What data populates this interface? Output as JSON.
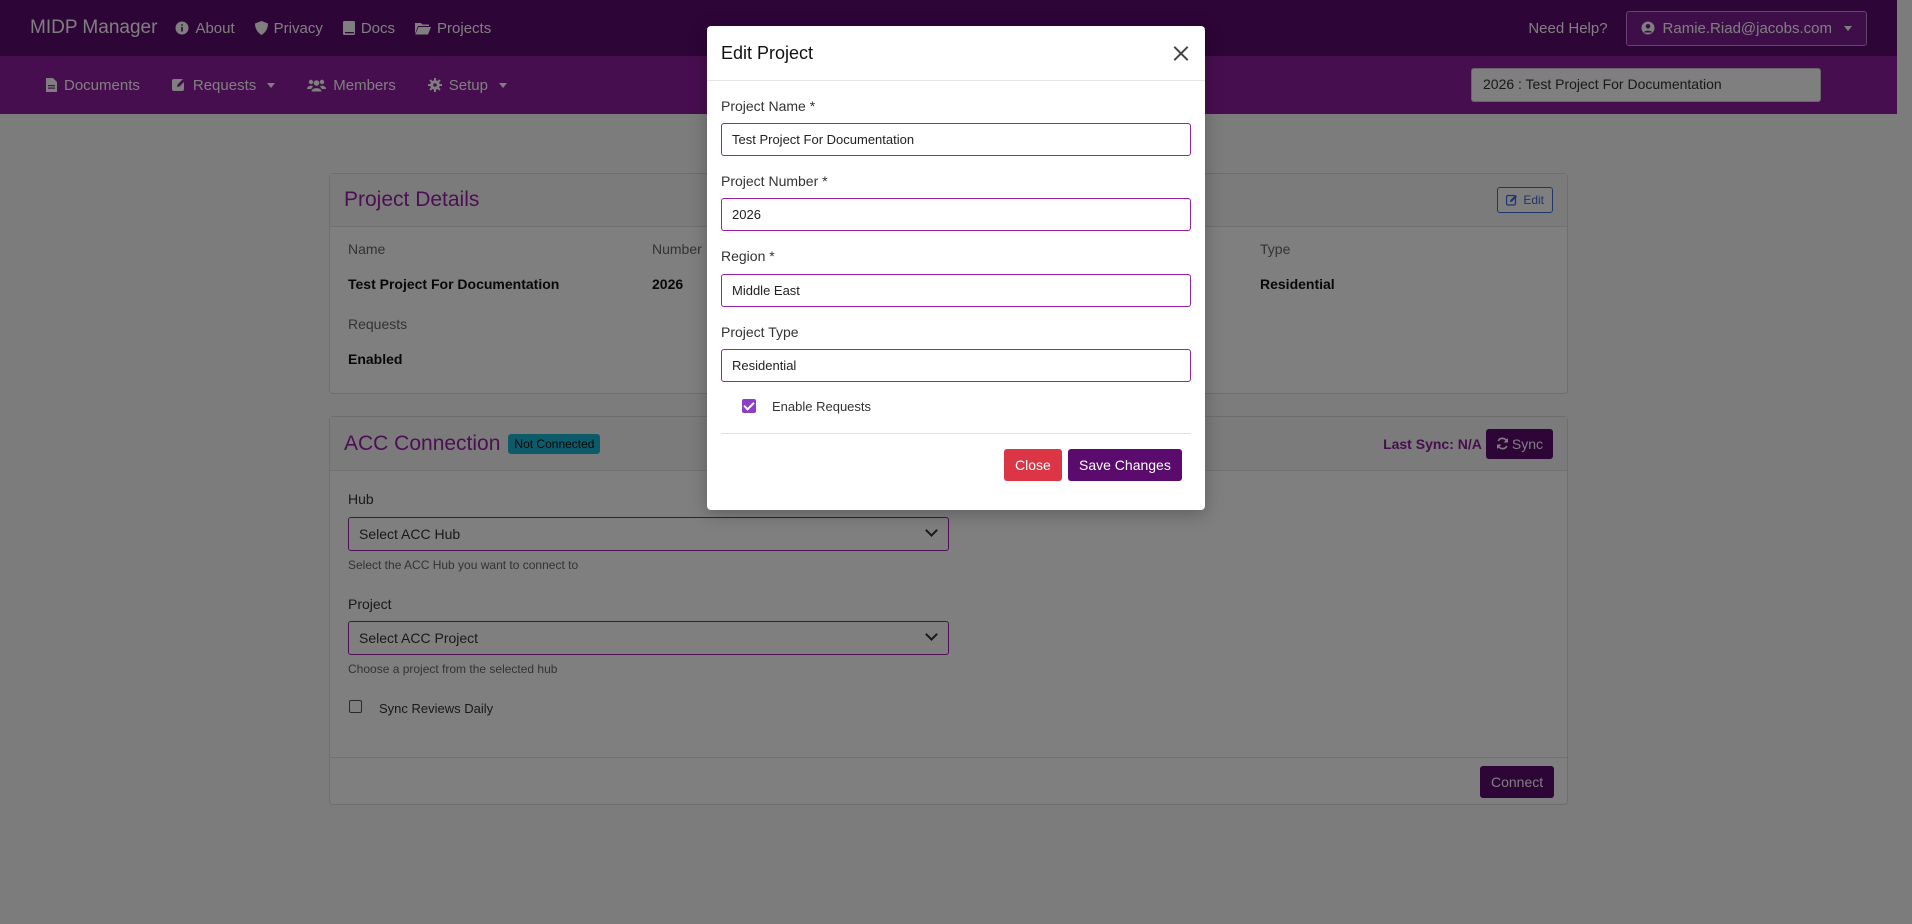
{
  "topbar": {
    "brand": "MIDP Manager",
    "nav": [
      {
        "label": "About",
        "icon": "info-icon"
      },
      {
        "label": "Privacy",
        "icon": "shield-icon"
      },
      {
        "label": "Docs",
        "icon": "book-icon"
      },
      {
        "label": "Projects",
        "icon": "folder-icon"
      }
    ],
    "help": "Need Help?",
    "user": "Ramie.Riad@jacobs.com"
  },
  "subbar": {
    "nav": [
      {
        "label": "Documents",
        "icon": "document-icon"
      },
      {
        "label": "Requests",
        "icon": "edit-square-icon",
        "dropdown": true
      },
      {
        "label": "Members",
        "icon": "users-icon"
      },
      {
        "label": "Setup",
        "icon": "gear-icon",
        "dropdown": true
      }
    ],
    "project_selector": "2026 : Test Project For Documentation"
  },
  "project_details": {
    "title": "Project Details",
    "edit_label": "Edit",
    "fields": {
      "name_label": "Name",
      "name_value": "Test Project For Documentation",
      "number_label": "Number",
      "number_value": "2026",
      "type_label": "Type",
      "type_value": "Residential",
      "requests_label": "Requests",
      "requests_value": "Enabled"
    }
  },
  "acc_connection": {
    "title": "ACC Connection",
    "status_badge": "Not Connected",
    "last_sync": "Last Sync: N/A",
    "sync_label": "Sync",
    "hub_label": "Hub",
    "hub_placeholder": "Select ACC Hub",
    "hub_hint": "Select the ACC Hub you want to connect to",
    "project_label": "Project",
    "project_placeholder": "Select ACC Project",
    "project_hint": "Choose a project from the selected hub",
    "sync_daily_label": "Sync Reviews Daily",
    "connect_label": "Connect"
  },
  "modal": {
    "title": "Edit Project",
    "project_name_label": "Project Name *",
    "project_name_value": "Test Project For Documentation",
    "project_number_label": "Project Number *",
    "project_number_value": "2026",
    "region_label": "Region *",
    "region_value": "Middle East",
    "project_type_label": "Project Type",
    "project_type_value": "Residential",
    "enable_requests_label": "Enable Requests",
    "enable_requests_checked": true,
    "close_label": "Close",
    "save_label": "Save Changes"
  },
  "colors": {
    "primary": "#5b0a6e",
    "secondary": "#8e1d9e",
    "danger": "#dc3545",
    "badge": "#1bb5d2"
  }
}
